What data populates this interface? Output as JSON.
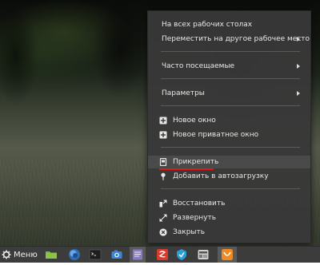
{
  "context_menu": {
    "items": [
      {
        "label": "На всех рабочих столах",
        "submenu": false
      },
      {
        "label": "Переместить на другое рабочее место",
        "submenu": true
      },
      {
        "label": "Часто посещаемые",
        "submenu": true
      },
      {
        "label": "Параметры",
        "submenu": true
      },
      {
        "label": "Новое окно",
        "icon": "new-window-icon"
      },
      {
        "label": "Новое приватное окно",
        "icon": "private-window-icon"
      },
      {
        "label": "Прикрепить",
        "icon": "pin-icon",
        "highlighted": true
      },
      {
        "label": "Добавить в автозагрузку",
        "icon": "autostart-icon"
      },
      {
        "label": "Восстановить",
        "icon": "restore-icon"
      },
      {
        "label": "Развернуть",
        "icon": "maximize-icon"
      },
      {
        "label": "Закрыть",
        "icon": "close-icon"
      }
    ],
    "annotation_color": "#e01818"
  },
  "taskbar": {
    "menu_label": "Меню",
    "menu_icon": "gear-icon",
    "apps": [
      {
        "name": "files",
        "icon": "folder-icon",
        "color": "#7cb342"
      },
      {
        "name": "browser",
        "icon": "globe-icon",
        "color": "#2f6db5"
      },
      {
        "name": "terminal",
        "icon": "terminal-icon",
        "color": "#222222"
      },
      {
        "name": "camera",
        "icon": "camera-icon",
        "color": "#3a86d9"
      },
      {
        "name": "text-editor",
        "icon": "text-editor-icon",
        "color": "#8a7cc0",
        "active": true
      },
      {
        "name": "software-center",
        "icon": "software-center-icon",
        "color": "#d83a2e"
      },
      {
        "name": "vpn",
        "icon": "vpn-icon",
        "color": "#2a9fd6"
      },
      {
        "name": "settings",
        "icon": "settings-app-icon",
        "color": "#cfcfcf"
      },
      {
        "name": "app-active",
        "icon": "orange-app-icon",
        "color": "#f08a24",
        "active": true
      }
    ]
  }
}
